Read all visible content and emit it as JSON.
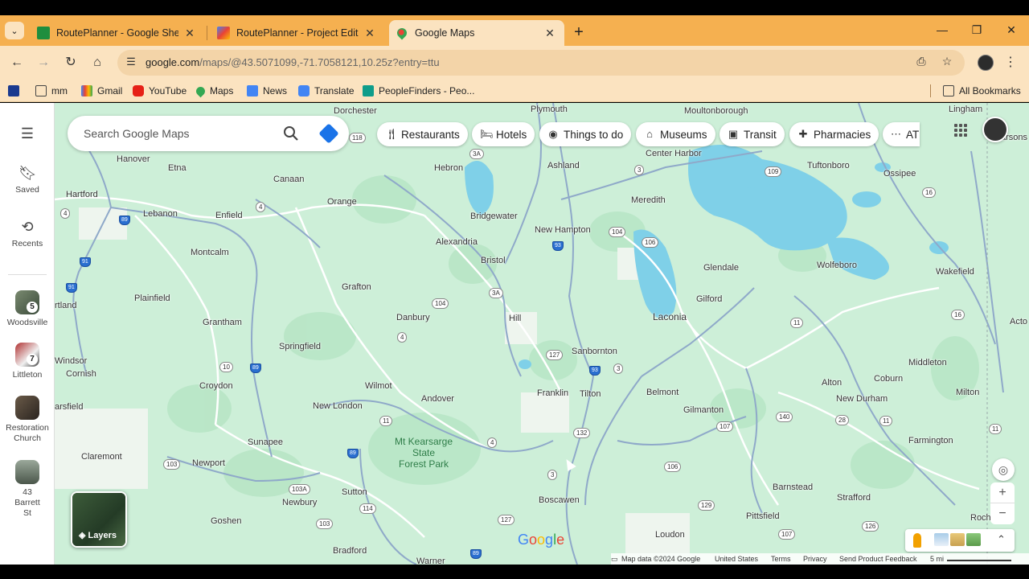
{
  "browser": {
    "tabs": [
      {
        "label": "RoutePlanner - Google Sheets",
        "icon": "sheets-icon",
        "color": "#1e8e3e"
      },
      {
        "label": "RoutePlanner - Project Editor - A",
        "icon": "apps-script-icon",
        "color": "#e8a03a"
      },
      {
        "label": "Google Maps",
        "icon": "maps-icon",
        "color": "#34a853"
      }
    ],
    "url": "google.com/maps/@43.5071099,-71.7058121,10.25z?entry=ttu",
    "url_host": "google.com",
    "url_path": "/maps/@43.5071099,-71.7058121,10.25z?entry=ttu",
    "bookmarks": [
      {
        "label": "mm",
        "icon": "folder-icon"
      },
      {
        "label": "Gmail",
        "icon": "gmail-icon"
      },
      {
        "label": "YouTube",
        "icon": "youtube-icon"
      },
      {
        "label": "Maps",
        "icon": "maps-icon"
      },
      {
        "label": "News",
        "icon": "news-icon"
      },
      {
        "label": "Translate",
        "icon": "translate-icon"
      },
      {
        "label": "PeopleFinders - Peo...",
        "icon": "peoplefinders-icon"
      }
    ],
    "all_bookmarks": "All Bookmarks"
  },
  "maps": {
    "search_placeholder": "Search Google Maps",
    "chips": [
      "Restaurants",
      "Hotels",
      "Things to do",
      "Museums",
      "Transit",
      "Pharmacies",
      "ATI"
    ],
    "sidebar": {
      "saved": "Saved",
      "recents": "Recents",
      "recent_places": [
        {
          "label": "Woodsville",
          "badge": "5"
        },
        {
          "label": "Littleton",
          "badge": "7"
        },
        {
          "label": "Restoration Church",
          "badge": ""
        },
        {
          "label": "43 Barrett St",
          "badge": ""
        }
      ]
    },
    "layers_label": "Layers",
    "logo": "Google",
    "footer": {
      "map_data": "Map data ©2024 Google",
      "country": "United States",
      "terms": "Terms",
      "privacy": "Privacy",
      "feedback": "Send Product Feedback",
      "scale": "5 mi"
    },
    "towns": [
      "Dorchester",
      "Plymouth",
      "Moultonborough",
      "Lingham",
      "Hanover",
      "Etna",
      "Canaan",
      "Hebron",
      "Ashland",
      "Center Harbor",
      "Tuftonboro",
      "Ossipee",
      "arsons",
      "Hartford",
      "Lebanon",
      "Enfield",
      "Orange",
      "Bridgewater",
      "Meredith",
      "Montcalm",
      "Alexandria",
      "New Hampton",
      "Bristol",
      "Glendale",
      "Wolfeboro",
      "Wakefield",
      "Grafton",
      "Plainfield",
      "Gilford",
      "rtland",
      "Grantham",
      "Danbury",
      "Hill",
      "Laconia",
      "Acto",
      "Springfield",
      "Sanbornton",
      "Middleton",
      "Windsor",
      "Cornish",
      "Croydon",
      "Wilmot",
      "Franklin",
      "Tilton",
      "Belmont",
      "Alton",
      "Coburn",
      "New Durham",
      "Milton",
      "Andover",
      "New London",
      "Gilmanton",
      "arsfield",
      "Sunapee",
      "Farmington",
      "Claremont",
      "Newport",
      "Barnstead",
      "Strafford",
      "Sutton",
      "Newbury",
      "Boscawen",
      "Pittsfield",
      "Roch",
      "Goshen",
      "Loudon",
      "Bradford",
      "Warner"
    ],
    "park": [
      "Mt Kearsarge",
      "State",
      "Forest Park"
    ]
  }
}
